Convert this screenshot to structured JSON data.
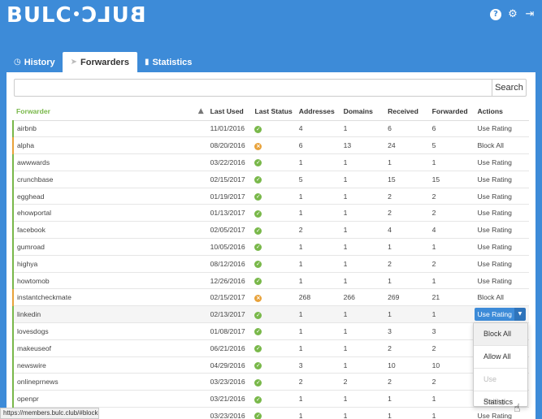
{
  "logo": {
    "left": "BULC",
    "right": "BULC"
  },
  "icons": {
    "help": "question-icon",
    "settings": "gear-icon",
    "logout": "logout-icon"
  },
  "tabs": [
    {
      "label": "History",
      "icon": "clock-icon"
    },
    {
      "label": "Forwarders",
      "icon": "paper-plane-icon",
      "active": true
    },
    {
      "label": "Statistics",
      "icon": "bar-chart-icon"
    }
  ],
  "search": {
    "placeholder": "",
    "value": "",
    "button": "Search"
  },
  "table": {
    "headers": [
      "Forwarder",
      "Last Used",
      "Last Status",
      "Addresses",
      "Domains",
      "Received",
      "Forwarded",
      "Actions"
    ],
    "rows": [
      {
        "forwarder": "airbnb",
        "last_used": "11/01/2016",
        "status": "ok",
        "addresses": "4",
        "domains": "1",
        "received": "6",
        "forwarded": "6",
        "action": "Use Rating"
      },
      {
        "forwarder": "alpha",
        "last_used": "08/20/2016",
        "status": "warn",
        "addresses": "6",
        "domains": "13",
        "received": "24",
        "forwarded": "5",
        "action": "Block All"
      },
      {
        "forwarder": "awwwards",
        "last_used": "03/22/2016",
        "status": "ok",
        "addresses": "1",
        "domains": "1",
        "received": "1",
        "forwarded": "1",
        "action": "Use Rating"
      },
      {
        "forwarder": "crunchbase",
        "last_used": "02/15/2017",
        "status": "ok",
        "addresses": "5",
        "domains": "1",
        "received": "15",
        "forwarded": "15",
        "action": "Use Rating"
      },
      {
        "forwarder": "egghead",
        "last_used": "01/19/2017",
        "status": "ok",
        "addresses": "1",
        "domains": "1",
        "received": "2",
        "forwarded": "2",
        "action": "Use Rating"
      },
      {
        "forwarder": "ehowportal",
        "last_used": "01/13/2017",
        "status": "ok",
        "addresses": "1",
        "domains": "1",
        "received": "2",
        "forwarded": "2",
        "action": "Use Rating"
      },
      {
        "forwarder": "facebook",
        "last_used": "02/05/2017",
        "status": "ok",
        "addresses": "2",
        "domains": "1",
        "received": "4",
        "forwarded": "4",
        "action": "Use Rating"
      },
      {
        "forwarder": "gumroad",
        "last_used": "10/05/2016",
        "status": "ok",
        "addresses": "1",
        "domains": "1",
        "received": "1",
        "forwarded": "1",
        "action": "Use Rating"
      },
      {
        "forwarder": "highya",
        "last_used": "08/12/2016",
        "status": "ok",
        "addresses": "1",
        "domains": "1",
        "received": "2",
        "forwarded": "2",
        "action": "Use Rating"
      },
      {
        "forwarder": "howtomob",
        "last_used": "12/26/2016",
        "status": "ok",
        "addresses": "1",
        "domains": "1",
        "received": "1",
        "forwarded": "1",
        "action": "Use Rating"
      },
      {
        "forwarder": "instantcheckmate",
        "last_used": "02/15/2017",
        "status": "warn",
        "addresses": "268",
        "domains": "266",
        "received": "269",
        "forwarded": "21",
        "action": "Block All"
      },
      {
        "forwarder": "linkedin",
        "last_used": "02/13/2017",
        "status": "ok",
        "addresses": "1",
        "domains": "1",
        "received": "1",
        "forwarded": "1",
        "action": "Use Rating",
        "open": true
      },
      {
        "forwarder": "lovesdogs",
        "last_used": "01/08/2017",
        "status": "ok",
        "addresses": "1",
        "domains": "1",
        "received": "3",
        "forwarded": "3",
        "action": ""
      },
      {
        "forwarder": "makeuseof",
        "last_used": "06/21/2016",
        "status": "ok",
        "addresses": "1",
        "domains": "1",
        "received": "2",
        "forwarded": "2",
        "action": ""
      },
      {
        "forwarder": "newswire",
        "last_used": "04/29/2016",
        "status": "ok",
        "addresses": "3",
        "domains": "1",
        "received": "10",
        "forwarded": "10",
        "action": ""
      },
      {
        "forwarder": "onlineprnews",
        "last_used": "03/23/2016",
        "status": "ok",
        "addresses": "2",
        "domains": "2",
        "received": "2",
        "forwarded": "2",
        "action": ""
      },
      {
        "forwarder": "openpr",
        "last_used": "03/21/2016",
        "status": "ok",
        "addresses": "1",
        "domains": "1",
        "received": "1",
        "forwarded": "1",
        "action": ""
      },
      {
        "forwarder": "",
        "last_used": "03/23/2016",
        "status": "ok",
        "addresses": "1",
        "domains": "1",
        "received": "1",
        "forwarded": "1",
        "action": "Use Rating"
      }
    ]
  },
  "dropdown": {
    "items": [
      {
        "label": "Block All",
        "hover": true
      },
      {
        "label": "Allow All"
      },
      {
        "label": "Use Rating",
        "disabled": true
      },
      {
        "label": "Statistics"
      }
    ]
  },
  "statusbar": {
    "url": "https://members.bulc.club/#block-all"
  },
  "colors": {
    "brand": "#3d8bd8",
    "ok": "#79b84a",
    "warn": "#e8a23a"
  }
}
